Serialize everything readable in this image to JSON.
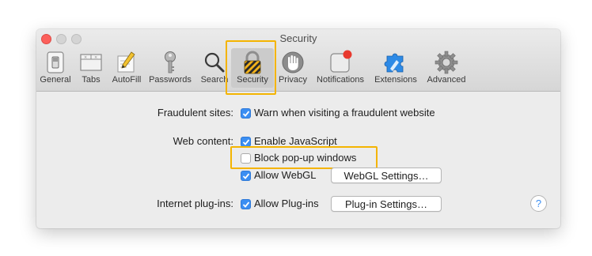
{
  "window": {
    "title": "Security"
  },
  "toolbar": {
    "items": [
      {
        "label": "General",
        "icon": "general-switch-icon"
      },
      {
        "label": "Tabs",
        "icon": "tabs-icon"
      },
      {
        "label": "AutoFill",
        "icon": "autofill-pencil-icon"
      },
      {
        "label": "Passwords",
        "icon": "key-icon"
      },
      {
        "label": "Search",
        "icon": "search-icon"
      },
      {
        "label": "Security",
        "icon": "lock-icon",
        "selected": true
      },
      {
        "label": "Privacy",
        "icon": "hand-icon"
      },
      {
        "label": "Notifications",
        "icon": "notifications-icon"
      },
      {
        "label": "Extensions",
        "icon": "puzzle-icon"
      },
      {
        "label": "Advanced",
        "icon": "gear-icon"
      }
    ]
  },
  "fraudulent": {
    "label": "Fraudulent sites:",
    "warn_label": "Warn when visiting a fraudulent website",
    "warn_checked": true
  },
  "web_content": {
    "label": "Web content:",
    "javascript_label": "Enable JavaScript",
    "javascript_checked": true,
    "popups_label": "Block pop-up windows",
    "popups_checked": false,
    "webgl_label": "Allow WebGL",
    "webgl_checked": true,
    "webgl_settings_button": "WebGL Settings…"
  },
  "plugins": {
    "label": "Internet plug-ins:",
    "allow_label": "Allow Plug-ins",
    "allow_checked": true,
    "settings_button": "Plug-in Settings…"
  },
  "help": {
    "symbol": "?"
  },
  "colors": {
    "highlight": "#f4b400",
    "checkbox_on": "#3b8ef2",
    "close_button": "#fc605b"
  }
}
